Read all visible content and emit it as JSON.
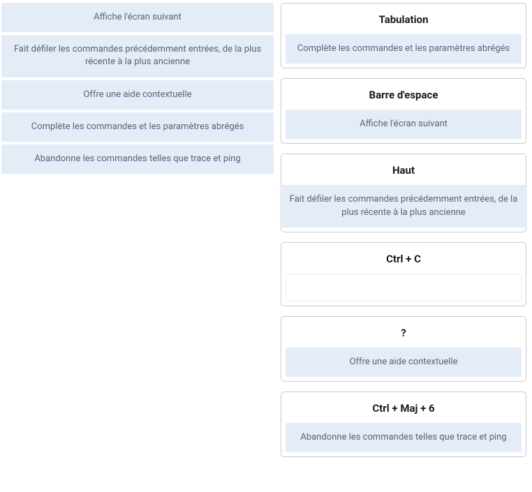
{
  "sources": [
    "Affiche l'écran suivant",
    "Fait défiler les commandes précédemment entrées, de la plus récente à la plus ancienne",
    "Offre une aide contextuelle",
    "Complète les commandes et les paramètres abrégés",
    "Abandonne les commandes telles que trace et ping"
  ],
  "targets": [
    {
      "title": "Tabulation",
      "answer": "Complète les commandes et les paramètres abrégés"
    },
    {
      "title": "Barre d'espace",
      "answer": "Affiche l'écran suivant"
    },
    {
      "title": "Haut",
      "answer": "Fait défiler les commandes précédemment entrées, de la plus récente à la plus ancienne"
    },
    {
      "title": "Ctrl + C",
      "answer": ""
    },
    {
      "title": "?",
      "answer": "Offre une aide contextuelle"
    },
    {
      "title": "Ctrl + Maj + 6",
      "answer": "Abandonne les commandes telles que trace et ping"
    }
  ]
}
